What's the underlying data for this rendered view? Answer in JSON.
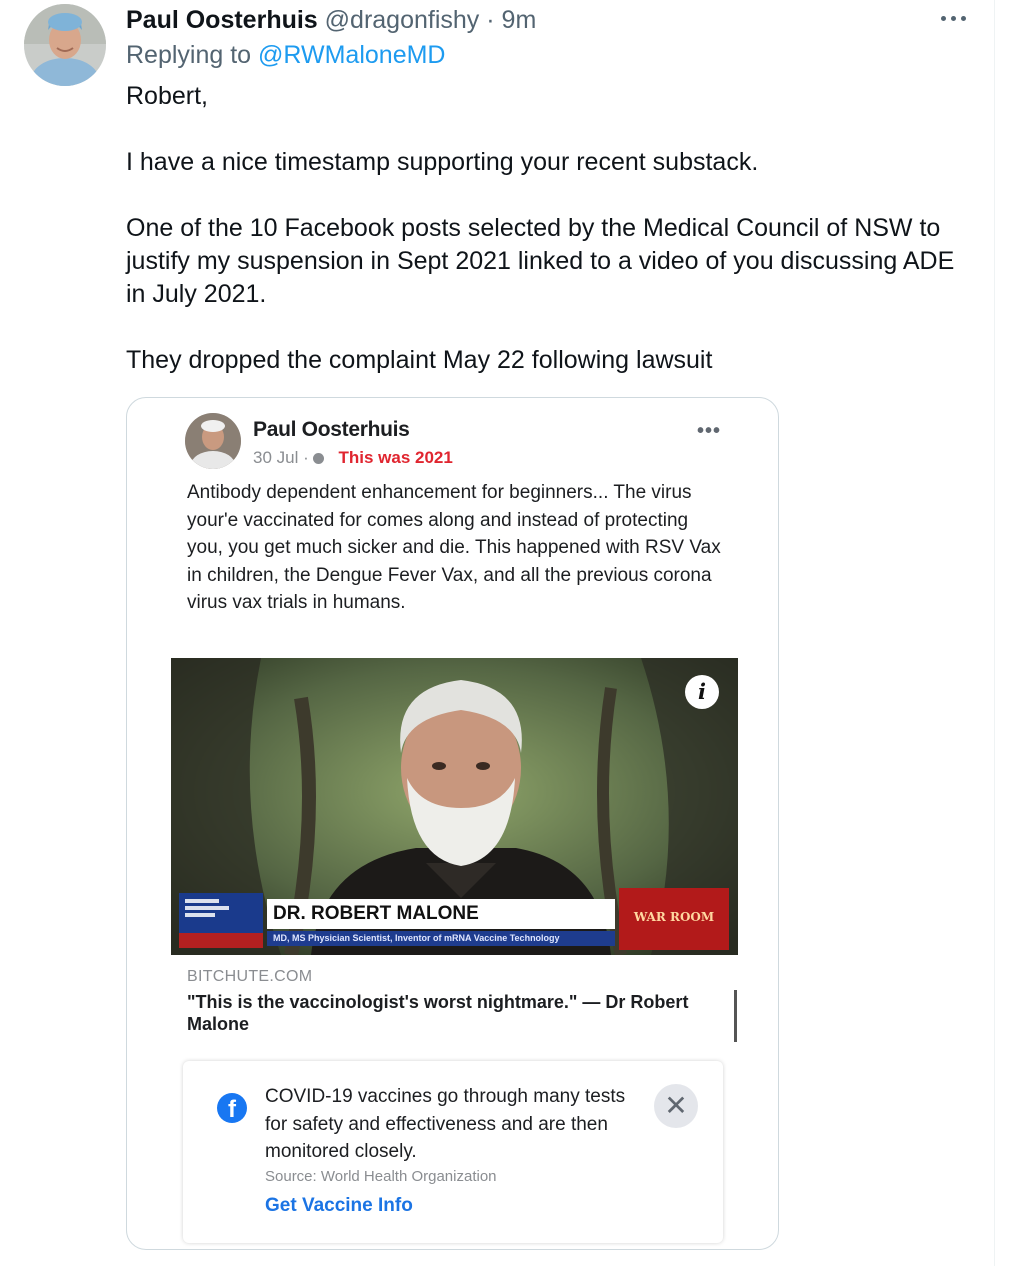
{
  "tweet": {
    "author_name": "Paul Oosterhuis",
    "handle": "@dragonfishy",
    "separator": "·",
    "time": "9m",
    "replying_prefix": "Replying to",
    "replying_to": "@RWMaloneMD",
    "paragraphs": [
      "Robert,",
      "I have a nice timestamp supporting your recent substack.",
      "One of the 10 Facebook posts selected by the Medical Council of NSW to justify my suspension in Sept 2021 linked to a video of you discussing ADE in July 2021.",
      "They dropped the complaint May 22 following lawsuit"
    ]
  },
  "embedded_post": {
    "author_name": "Paul Oosterhuis",
    "date": "30 Jul ·",
    "annotation": "This was 2021",
    "text": "Antibody dependent enhancement for beginners... The virus your'e vaccinated for comes along and instead of protecting you, you get much sicker and die. This happened with RSV Vax in children, the Dengue Fever Vax, and all the previous corona virus vax trials in humans.",
    "video": {
      "lower_third_name": "DR. ROBERT MALONE",
      "lower_third_subtitle": "MD, MS Physician Scientist, Inventor of mRNA Vaccine Technology",
      "badge": "WAR ROOM"
    },
    "link_domain": "BITCHUTE.COM",
    "link_title": "\"This is the vaccinologist's worst nightmare.\" — Dr Robert Malone",
    "covid_notice": {
      "text": "COVID-19 vaccines go through many tests for safety and effectiveness and are then monitored closely.",
      "source": "Source: World Health Organization",
      "link": "Get Vaccine Info"
    }
  },
  "icons": {
    "more": "more-horizontal-icon",
    "info": "info-icon",
    "facebook": "facebook-icon",
    "close": "close-icon",
    "globe": "globe-icon"
  },
  "colors": {
    "link_blue": "#1d9bf0",
    "muted_gray": "#536471",
    "annotation_red": "#e0252f",
    "facebook_blue": "#1877f2"
  }
}
